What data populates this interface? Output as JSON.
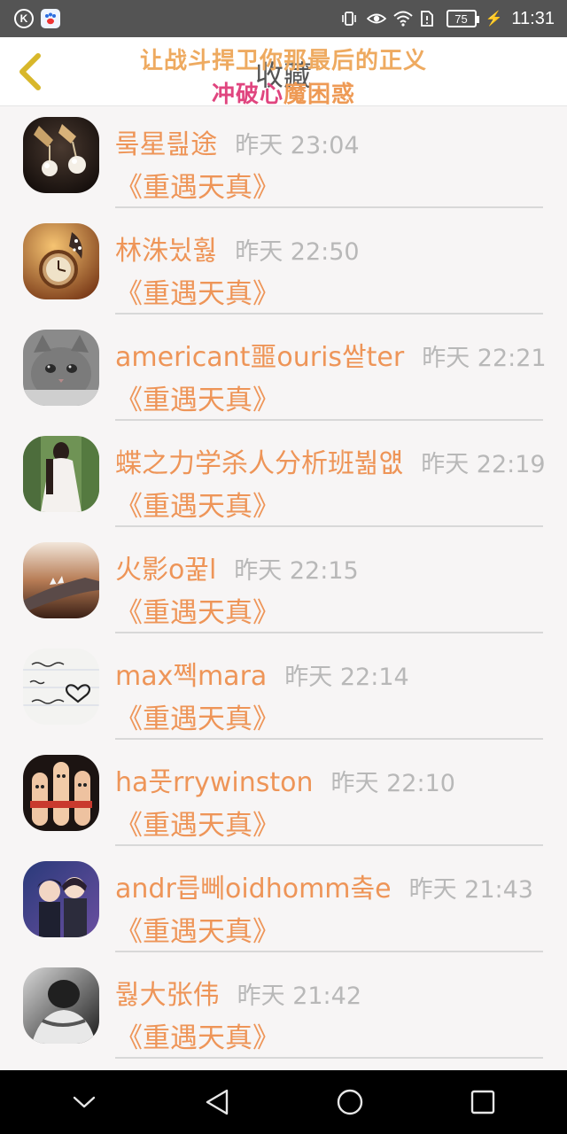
{
  "status_bar": {
    "left_icons": [
      "k-app-icon",
      "baidu-paw-icon"
    ],
    "right_icons": [
      "vibrate-icon",
      "eye-icon",
      "wifi-icon",
      "sim-alert-icon",
      "battery-icon",
      "charging-icon"
    ],
    "battery": "75",
    "time": "11:31"
  },
  "header": {
    "back_icon": "chevron-left-icon",
    "title": "收藏",
    "overlay_line1": "让战斗捍卫你那最后的正义",
    "overlay_line2_a": "冲破心",
    "overlay_line2_b": "魔困惑"
  },
  "list": {
    "items": [
      {
        "name": "뤀星릞途",
        "time": "昨天 23:04",
        "subtitle": "《重遇天真》",
        "avatar": "earrings-photo"
      },
      {
        "name": "林洙뉬훯",
        "time": "昨天 22:50",
        "subtitle": "《重遇天真》",
        "avatar": "pocket-watch-photo"
      },
      {
        "name": "americant噩ouris쌑ter",
        "time": "昨天 22:21",
        "subtitle": "《重遇天真》",
        "avatar": "kitten-photo"
      },
      {
        "name": "蝶之力学杀人分析班붦얪",
        "time": "昨天 22:19",
        "subtitle": "《重遇天真》",
        "avatar": "white-dress-photo"
      },
      {
        "name": "火影o꿅l",
        "time": "昨天 22:15",
        "subtitle": "《重遇天真》",
        "avatar": "sunset-hand-photo"
      },
      {
        "name": "max쪡mara",
        "time": "昨天 22:14",
        "subtitle": "《重遇天真》",
        "avatar": "handwriting-heart-photo"
      },
      {
        "name": "ha풋rrywinston",
        "time": "昨天 22:10",
        "subtitle": "《重遇天真》",
        "avatar": "finger-faces-photo"
      },
      {
        "name": "andr릅뻬oidhomm춬e",
        "time": "昨天 21:43",
        "subtitle": "《重遇天真》",
        "avatar": "anime-couple-photo"
      },
      {
        "name": "뤓大张伟",
        "time": "昨天 21:42",
        "subtitle": "《重遇天真》",
        "avatar": "bw-hug-photo"
      }
    ]
  },
  "nav_bar": {
    "icons": [
      "collapse-chevron-icon",
      "back-triangle-icon",
      "home-circle-icon",
      "recents-square-icon"
    ]
  },
  "colors": {
    "accent_orange": "#ee9558",
    "time_gray": "#b8b8b8",
    "overlay_pink": "#e0457f",
    "status_bar": "#545454"
  }
}
